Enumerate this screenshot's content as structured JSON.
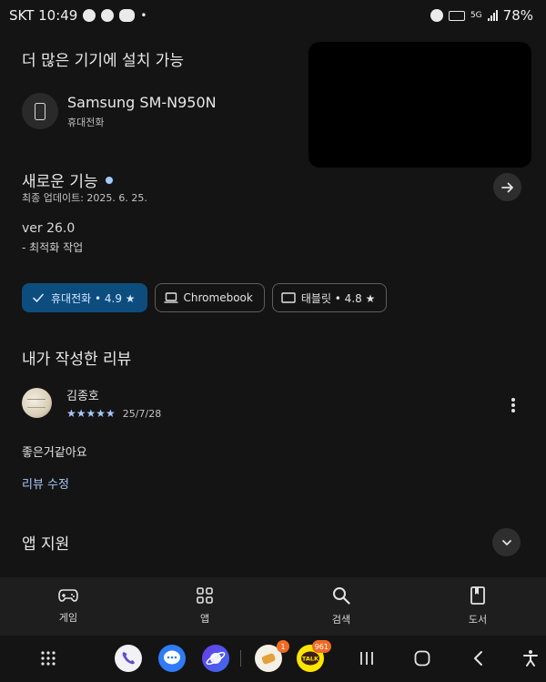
{
  "status_bar": {
    "carrier_time": "SKT 10:49",
    "dot": "•",
    "network": "5G",
    "battery": "78%"
  },
  "devices_section": {
    "title": "더 많은 기기에 설치 가능",
    "device_name": "Samsung SM-N950N",
    "device_type": "휴대전화"
  },
  "whats_new": {
    "title": "새로운 기능",
    "update_date": "최종 업데이트: 2025. 6. 25.",
    "version": "ver 26.0",
    "note": "- 최적화 작업"
  },
  "rating_chips": [
    {
      "label": "휴대전화 • 4.9 ★",
      "selected": true,
      "icon": "check-icon"
    },
    {
      "label": "Chromebook",
      "selected": false,
      "icon": "laptop-icon"
    },
    {
      "label": "태블릿 • 4.8 ★",
      "selected": false,
      "icon": "tablet-icon"
    }
  ],
  "my_review": {
    "title": "내가 작성한 리뷰",
    "reviewer": "김종호",
    "stars": "★★★★★",
    "date": "25/7/28",
    "body": "좋은거같아요",
    "edit_label": "리뷰 수정"
  },
  "app_support": {
    "title": "앱 지원"
  },
  "bottom_nav": [
    {
      "label": "게임",
      "icon": "gamepad-icon"
    },
    {
      "label": "앱",
      "icon": "apps-grid-icon"
    },
    {
      "label": "검색",
      "icon": "search-icon"
    },
    {
      "label": "도서",
      "icon": "book-icon"
    }
  ],
  "dock": {
    "badge_1": "1",
    "badge_2": "961",
    "talk_label": "TALK"
  },
  "colors": {
    "accent": "#a8c7fa",
    "selected_chip": "#0c4d7e",
    "background": "#141414"
  }
}
